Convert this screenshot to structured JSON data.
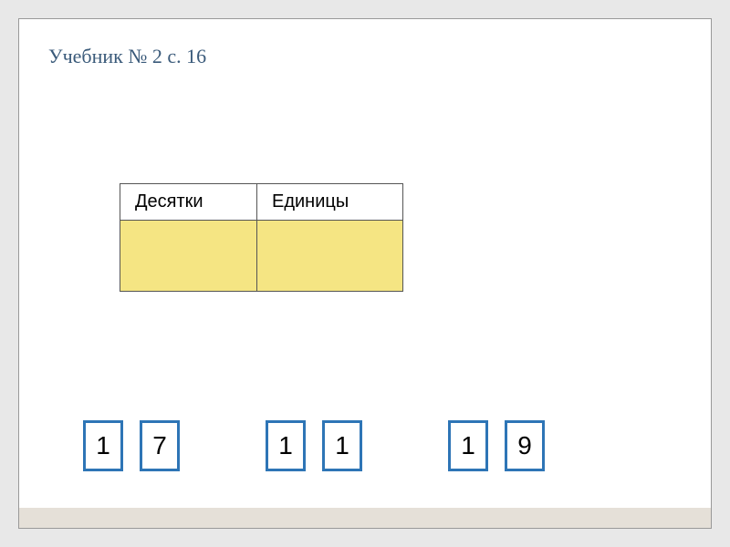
{
  "title": "Учебник № 2 с. 16",
  "table": {
    "headers": {
      "tens": "Десятки",
      "units": "Единицы"
    }
  },
  "cards": {
    "pairs": [
      {
        "left": "1",
        "right": "7"
      },
      {
        "left": "1",
        "right": "1"
      },
      {
        "left": "1",
        "right": "9"
      }
    ]
  }
}
